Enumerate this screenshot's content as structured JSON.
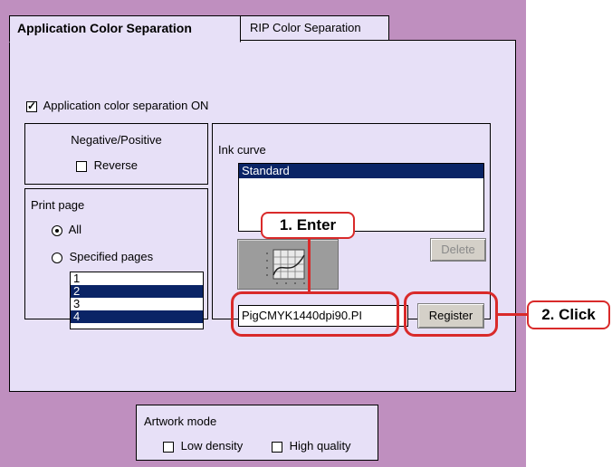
{
  "tabs": {
    "application": "Application Color Separation",
    "rip": "RIP Color Separation"
  },
  "app_sep_checkbox": {
    "label": "Application color separation ON",
    "checked": true
  },
  "negative_positive": {
    "title": "Negative/Positive",
    "reverse_label": "Reverse",
    "reverse_checked": false
  },
  "print_page": {
    "title": "Print page",
    "all_label": "All",
    "specified_label": "Specified pages",
    "selected": "All",
    "pages": [
      "1",
      "2",
      "3",
      "4"
    ],
    "selected_pages": [
      "2",
      "4"
    ]
  },
  "ink_curve": {
    "title": "Ink curve",
    "items": [
      "Standard"
    ],
    "selected": "Standard",
    "delete_label": "Delete",
    "name_value": "PigCMYK1440dpi90.PI",
    "register_label": "Register",
    "curve_icon": "curve-graph-icon"
  },
  "artwork_mode": {
    "title": "Artwork mode",
    "low_density_label": "Low density",
    "low_density_checked": false,
    "high_quality_label": "High quality",
    "high_quality_checked": false
  },
  "annotations": {
    "step1": "1. Enter",
    "step2": "2. Click",
    "color": "#d92a2a"
  }
}
